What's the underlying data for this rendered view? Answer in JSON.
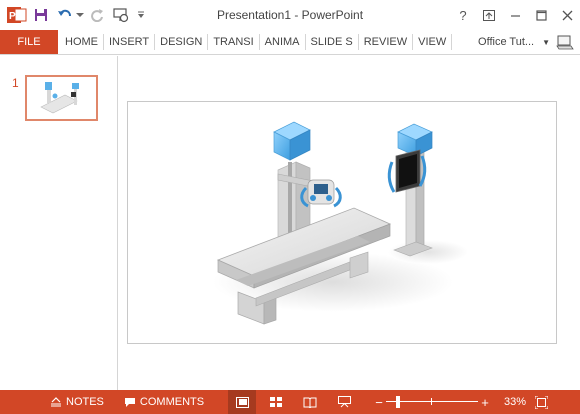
{
  "app": {
    "title": "Presentation1 - PowerPoint",
    "accent_color": "#d24726",
    "qat_icons": [
      "powerpoint-icon",
      "save-icon",
      "undo-icon",
      "redo-icon",
      "start-from-beginning-icon",
      "customize-qat-icon"
    ]
  },
  "window_controls": {
    "help_label": "?",
    "ribbon_display_icon": "ribbon-display-icon",
    "minimize_icon": "minimize-icon",
    "maximize_icon": "maximize-icon",
    "close_icon": "close-icon"
  },
  "ribbon": {
    "file_tab": "FILE",
    "tabs": [
      "HOME",
      "INSERT",
      "DESIGN",
      "TRANSI",
      "ANIMA",
      "SLIDE S",
      "REVIEW",
      "VIEW"
    ],
    "account_name": "Office Tut..."
  },
  "thumbnails": {
    "items": [
      {
        "number": "1",
        "selected": true
      }
    ]
  },
  "status_bar": {
    "notes_label": "NOTES",
    "comments_label": "COMMENTS",
    "views": [
      "normal-view-icon",
      "slide-sorter-icon",
      "reading-view-icon",
      "slide-show-icon"
    ],
    "zoom_minus": "−",
    "zoom_plus": "+",
    "zoom_percent": "33%",
    "zoom_level_fraction": 0.33,
    "fit_icon": "fit-to-window-icon"
  }
}
